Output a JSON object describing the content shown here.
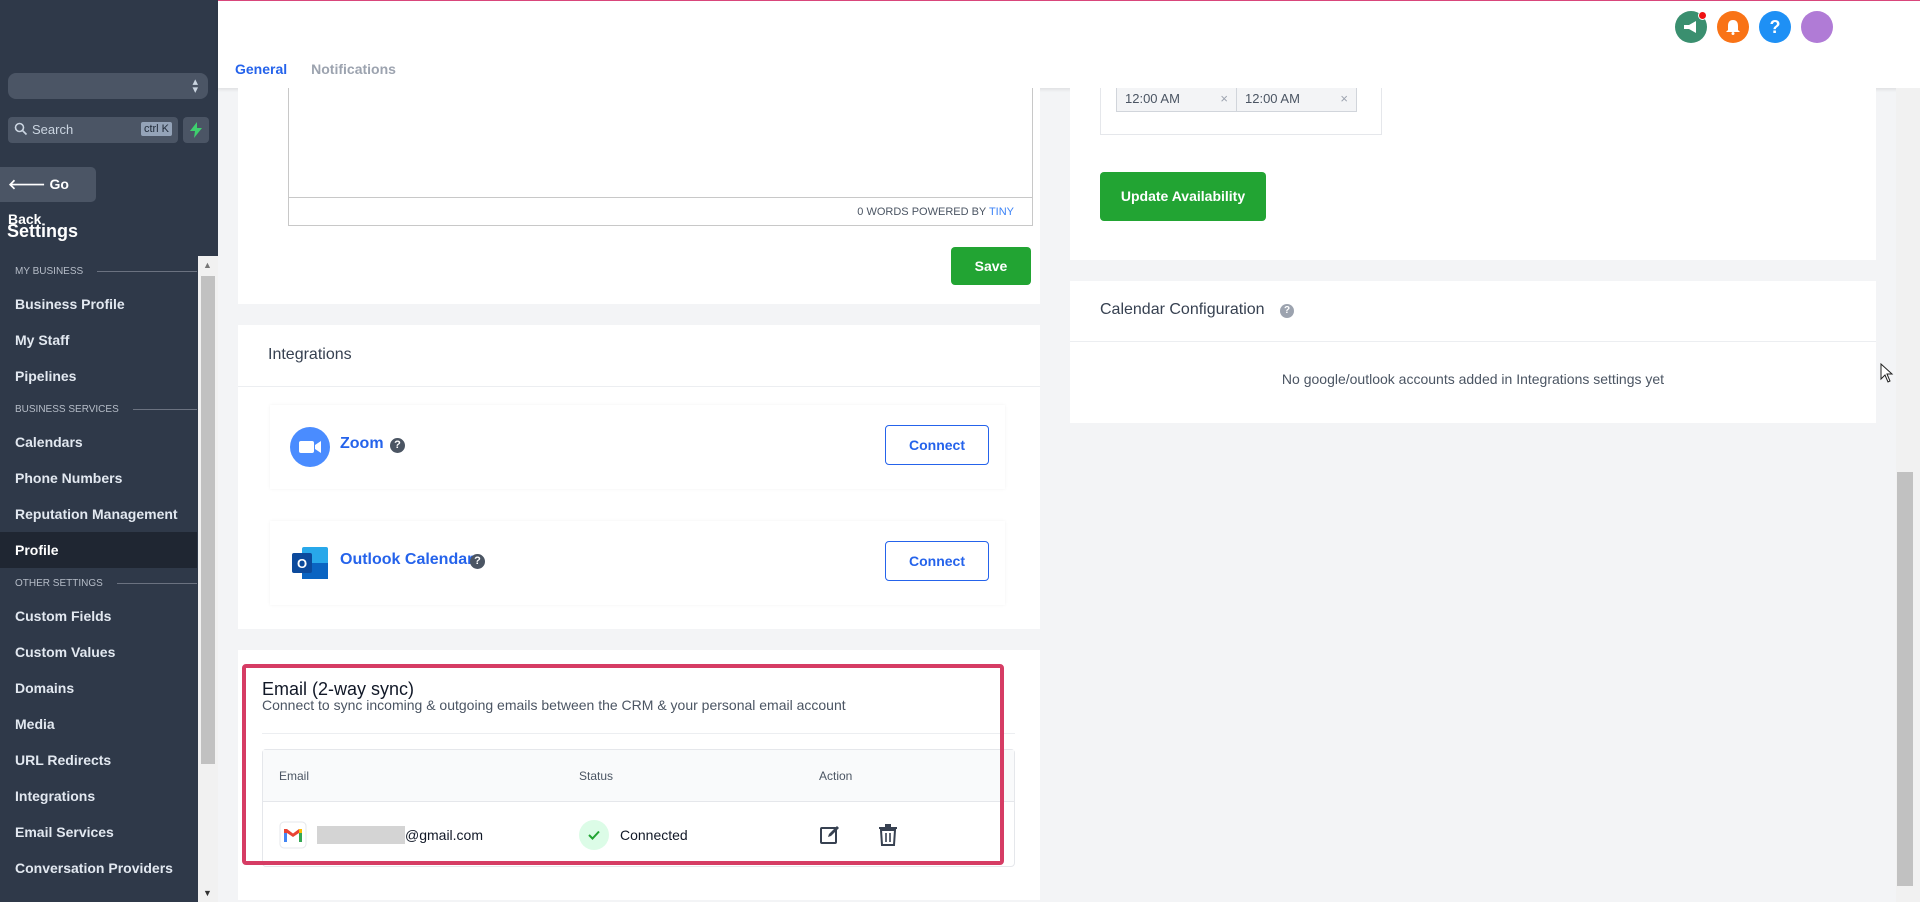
{
  "sidebar": {
    "search_placeholder": "Search",
    "search_shortcut": "ctrl K",
    "go_back": "Go Back",
    "settings_title": "Settings",
    "sections": [
      {
        "header": "MY BUSINESS",
        "items": [
          "Business Profile",
          "My Staff",
          "Pipelines"
        ]
      },
      {
        "header": "BUSINESS SERVICES",
        "items": [
          "Calendars",
          "Phone Numbers",
          "Reputation Management",
          "Profile"
        ]
      },
      {
        "header": "OTHER SETTINGS",
        "items": [
          "Custom Fields",
          "Custom Values",
          "Domains",
          "Media",
          "URL Redirects",
          "Integrations",
          "Email Services",
          "Conversation Providers"
        ]
      }
    ],
    "active_item": "Profile"
  },
  "header": {
    "tabs": [
      "General",
      "Notifications"
    ],
    "active_tab": "General",
    "icons": [
      "megaphone-icon",
      "bell-icon",
      "help-icon",
      "avatar"
    ]
  },
  "editor": {
    "word_count": "0 WORDS",
    "powered_by": "POWERED BY",
    "tiny": "TINY",
    "save": "Save"
  },
  "integrations": {
    "title": "Integrations",
    "items": [
      {
        "name": "Zoom",
        "action": "Connect"
      },
      {
        "name": "Outlook Calendar",
        "action": "Connect"
      }
    ]
  },
  "email_sync": {
    "title": "Email (2-way sync)",
    "description": "Connect to sync incoming & outgoing emails between the CRM & your personal email account",
    "columns": [
      "Email",
      "Status",
      "Action"
    ],
    "rows": [
      {
        "email": "@gmail.com",
        "status": "Connected"
      }
    ]
  },
  "availability": {
    "start_time": "12:00 AM",
    "end_time": "12:00 AM",
    "update_button": "Update Availability"
  },
  "calendar_config": {
    "title": "Calendar Configuration",
    "empty_message": "No google/outlook accounts added in Integrations settings yet"
  },
  "colors": {
    "sidebar_bg": "#2f3949",
    "primary_blue": "#2563eb",
    "success_green": "#22a433",
    "highlight": "#d63c64"
  }
}
